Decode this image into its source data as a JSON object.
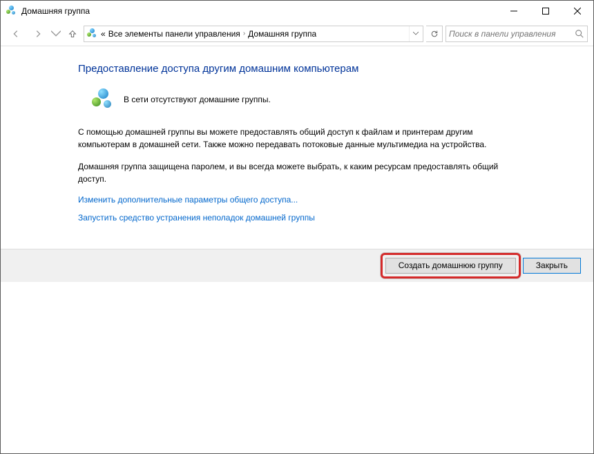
{
  "window": {
    "title": "Домашняя группа"
  },
  "breadcrumb": {
    "prefix": "«",
    "seg1": "Все элементы панели управления",
    "seg2": "Домашняя группа"
  },
  "search": {
    "placeholder": "Поиск в панели управления"
  },
  "page": {
    "title": "Предоставление доступа другим домашним компьютерам",
    "status": "В сети отсутствуют домашние группы.",
    "para1": "С помощью домашней группы вы можете предоставлять общий доступ к файлам и принтерам другим компьютерам в домашней сети. Также можно передавать потоковые данные мультимедиа на устройства.",
    "para2": "Домашняя группа защищена паролем, и вы всегда можете выбрать, к каким ресурсам предоставлять общий доступ.",
    "link1": "Изменить дополнительные параметры общего доступа...",
    "link2": "Запустить средство устранения неполадок домашней группы"
  },
  "buttons": {
    "create": "Создать домашнюю группу",
    "close": "Закрыть"
  }
}
